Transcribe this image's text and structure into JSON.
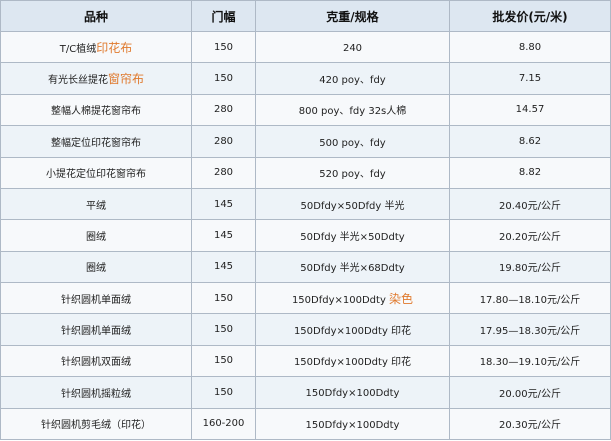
{
  "table": {
    "headers": [
      "品种",
      "门幅",
      "克重/规格",
      "批发价(元/米)"
    ],
    "rows": [
      {
        "name": "T/C植绒",
        "name_hl": "印花布",
        "width": "150",
        "spec": "240",
        "spec_hl": "",
        "price": "8.80"
      },
      {
        "name": "有光长丝提花",
        "name_hl": "窗帘布",
        "width": "150",
        "spec": "420 poy、fdy",
        "spec_hl": "",
        "price": "7.15"
      },
      {
        "name": "整幅人棉提花窗帘布",
        "name_hl": "",
        "width": "280",
        "spec": "800 poy、fdy 32s人棉",
        "spec_hl": "",
        "price": "14.57"
      },
      {
        "name": "整幅定位印花窗帘布",
        "name_hl": "",
        "width": "280",
        "spec": "500 poy、fdy",
        "spec_hl": "",
        "price": "8.62"
      },
      {
        "name": "小提花定位印花窗帘布",
        "name_hl": "",
        "width": "280",
        "spec": "520 poy、fdy",
        "spec_hl": "",
        "price": "8.82"
      },
      {
        "name": "平绒",
        "name_hl": "",
        "width": "145",
        "spec": "50Dfdy×50Dfdy 半光",
        "spec_hl": "",
        "price": "20.40元/公斤"
      },
      {
        "name": "圈绒",
        "name_hl": "",
        "width": "145",
        "spec": "50Dfdy 半光×50Ddty",
        "spec_hl": "",
        "price": "20.20元/公斤"
      },
      {
        "name": "圈绒",
        "name_hl": "",
        "width": "145",
        "spec": "50Dfdy 半光×68Ddty",
        "spec_hl": "",
        "price": "19.80元/公斤"
      },
      {
        "name": "针织圆机单面绒",
        "name_hl": "",
        "width": "150",
        "spec": "150Dfdy×100Ddty ",
        "spec_hl": "染色",
        "price": "17.80—18.10元/公斤"
      },
      {
        "name": "针织圆机单面绒",
        "name_hl": "",
        "width": "150",
        "spec": "150Dfdy×100Ddty 印花",
        "spec_hl": "",
        "price": "17.95—18.30元/公斤"
      },
      {
        "name": "针织圆机双面绒",
        "name_hl": "",
        "width": "150",
        "spec": "150Dfdy×100Ddty 印花",
        "spec_hl": "",
        "price": "18.30—19.10元/公斤"
      },
      {
        "name": "针织圆机摇粒绒",
        "name_hl": "",
        "width": "150",
        "spec": "150Dfdy×100Ddty",
        "spec_hl": "",
        "price": "20.00元/公斤"
      },
      {
        "name": "针织圆机剪毛绒（印花）",
        "name_hl": "",
        "width": "160-200",
        "spec": "150Dfdy×100Ddty",
        "spec_hl": "",
        "price": "20.30元/公斤"
      }
    ]
  }
}
